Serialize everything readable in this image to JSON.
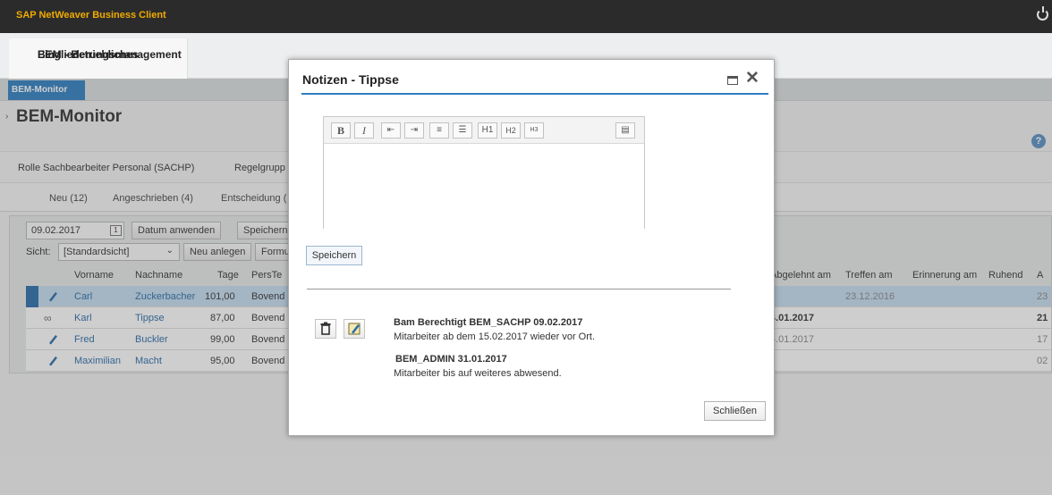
{
  "app": {
    "title": "SAP NetWeaver Business Client"
  },
  "workcenter": {
    "tab_label_line1": "BEM - Betriebliches",
    "tab_label_line2": "Eingliederungsmanagement"
  },
  "app_tab": {
    "label": "BEM-Monitor"
  },
  "page": {
    "title": "BEM-Monitor"
  },
  "filter": {
    "rolle_label": "Rolle",
    "rolle_value": "Sachbearbeiter Personal (SACHP)",
    "regelgruppe_label": "Regelgrupp"
  },
  "tabs": [
    {
      "label": "Neu (12)"
    },
    {
      "label": "Angeschrieben (4)"
    },
    {
      "label": "Entscheidung ("
    }
  ],
  "toolbar": {
    "date_value": "09.02.2017",
    "apply_date": "Datum anwenden",
    "save": "Speichern",
    "sicht_label": "Sicht:",
    "sicht_value": "[Standardsicht]",
    "new_button": "Neu anlegen",
    "form_button": "Formu"
  },
  "table": {
    "columns": [
      "Vorname",
      "Nachname",
      "Tage",
      "PersTe"
    ],
    "right_columns": [
      "Abgelehnt am",
      "Treffen am",
      "Erinnerung am",
      "Ruhend",
      "A"
    ],
    "rows": [
      {
        "vorname": "Carl",
        "nachname": "Zuckerbacher",
        "tage": "101,00",
        "pers": "Bovend",
        "abgelehnt": "",
        "treffen": "23.12.2016",
        "a": "23",
        "selected": true,
        "icon": "pencil-icon"
      },
      {
        "vorname": "Karl",
        "nachname": "Tippse",
        "tage": "87,00",
        "pers": "Bovend",
        "abgelehnt": "4.01.2017",
        "treffen": "",
        "a": "21",
        "selected": false,
        "icon": "glasses-icon"
      },
      {
        "vorname": "Fred",
        "nachname": "Buckler",
        "tage": "99,00",
        "pers": "Bovend",
        "abgelehnt": "4.01.2017",
        "treffen": "",
        "a": "17",
        "selected": false,
        "icon": "pencil-icon"
      },
      {
        "vorname": "Maximilian",
        "nachname": "Macht",
        "tage": "95,00",
        "pers": "Bovend",
        "abgelehnt": "",
        "treffen": "",
        "a": "02",
        "selected": false,
        "icon": "pencil-icon"
      }
    ]
  },
  "modal": {
    "title": "Notizen - Tippse",
    "editor_buttons": [
      "B",
      "I",
      "outdent",
      "indent",
      "ordered-list",
      "bullet-list",
      "H1",
      "H2",
      "H3",
      "justify"
    ],
    "editor_labels": {
      "bold": "B",
      "italic": "I",
      "h1": "H1",
      "h2": "H2",
      "h3": "H3"
    },
    "save": "Speichern",
    "notes": [
      {
        "head": "Bam Berechtigt BEM_SACHP 09.02.2017",
        "body": "Mitarbeiter ab dem 15.02.2017 wieder vor Ort."
      },
      {
        "head": "BEM_ADMIN 31.01.2017",
        "body": "Mitarbeiter bis auf weiteres abwesend."
      }
    ],
    "close": "Schließen"
  }
}
